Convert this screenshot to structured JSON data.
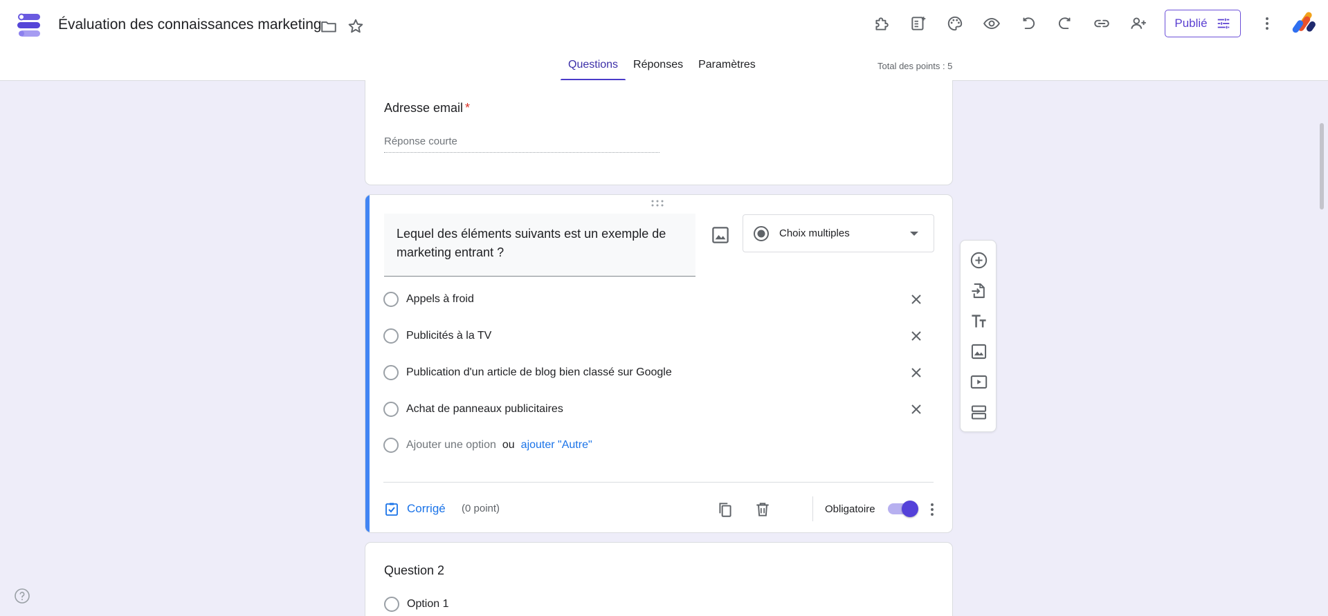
{
  "header": {
    "title": "Évaluation des connaissances marketing",
    "publish_label": "Publié",
    "icons": [
      "addons-icon",
      "quiz-editor-icon",
      "palette-icon",
      "preview-icon",
      "undo-icon",
      "redo-icon",
      "link-icon",
      "add-collaborator-icon",
      "tune-icon",
      "more-vert-icon"
    ]
  },
  "tabs": [
    {
      "label": "Questions",
      "active": true
    },
    {
      "label": "Réponses",
      "active": false
    },
    {
      "label": "Paramètres",
      "active": false
    }
  ],
  "total_points": "Total des points : 5",
  "email_card": {
    "label": "Adresse email",
    "required_mark": "*",
    "placeholder": "Réponse courte"
  },
  "question1": {
    "text": "Lequel des éléments suivants est un exemple de marketing entrant ?",
    "type": "Choix multiples",
    "options": [
      "Appels à froid",
      "Publicités à la TV",
      "Publication d'un article de blog bien classé sur Google",
      "Achat de panneaux publicitaires"
    ],
    "add_option": "Ajouter une option",
    "or": "ou",
    "add_other": "ajouter \"Autre\"",
    "answer_key": "Corrigé",
    "points": "(0 point)",
    "required_label": "Obligatoire",
    "required_on": true
  },
  "question2": {
    "title": "Question 2",
    "option1": "Option 1"
  },
  "colors": {
    "accent": "#5441d9",
    "link": "#1a73e8",
    "left_bar": "#4285f4",
    "background": "#eeedf9"
  }
}
